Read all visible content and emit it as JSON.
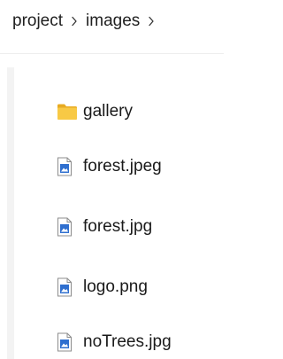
{
  "breadcrumb": {
    "items": [
      "project",
      "images"
    ],
    "separator_icon": "chevron-right-icon"
  },
  "files": [
    {
      "name": "gallery",
      "type": "folder",
      "icon": "folder-icon",
      "color": "#f8c945"
    },
    {
      "name": "forest.jpeg",
      "type": "image",
      "icon": "image-file-icon",
      "color": "#2f6fcf"
    },
    {
      "name": "forest.jpg",
      "type": "image",
      "icon": "image-file-icon",
      "color": "#2f6fcf"
    },
    {
      "name": "logo.png",
      "type": "image",
      "icon": "image-file-icon",
      "color": "#2f6fcf"
    },
    {
      "name": "noTrees.jpg",
      "type": "image",
      "icon": "image-file-icon",
      "color": "#2f6fcf"
    }
  ]
}
